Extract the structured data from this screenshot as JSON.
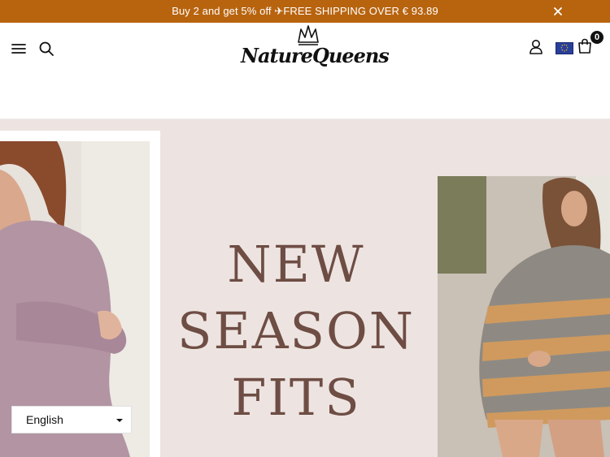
{
  "announcement": {
    "text": "Buy 2 and get 5% off ✈FREE SHIPPING OVER € 93.89",
    "close_icon": "close-icon"
  },
  "header": {
    "logo_text": "NatureQueens",
    "icons": [
      "menu-icon",
      "search-icon",
      "account-icon",
      "flag-eu-icon",
      "cart-icon"
    ],
    "cart_count": "0"
  },
  "hero": {
    "headline_lines": [
      "NEW",
      "SEASON",
      "FITS"
    ],
    "headline_color": "#6e4d44",
    "background": "#ede4e1"
  },
  "language_selector": {
    "selected": "English"
  },
  "colors": {
    "announcement_bg": "#b8640f",
    "announcement_text": "#ffffff"
  }
}
